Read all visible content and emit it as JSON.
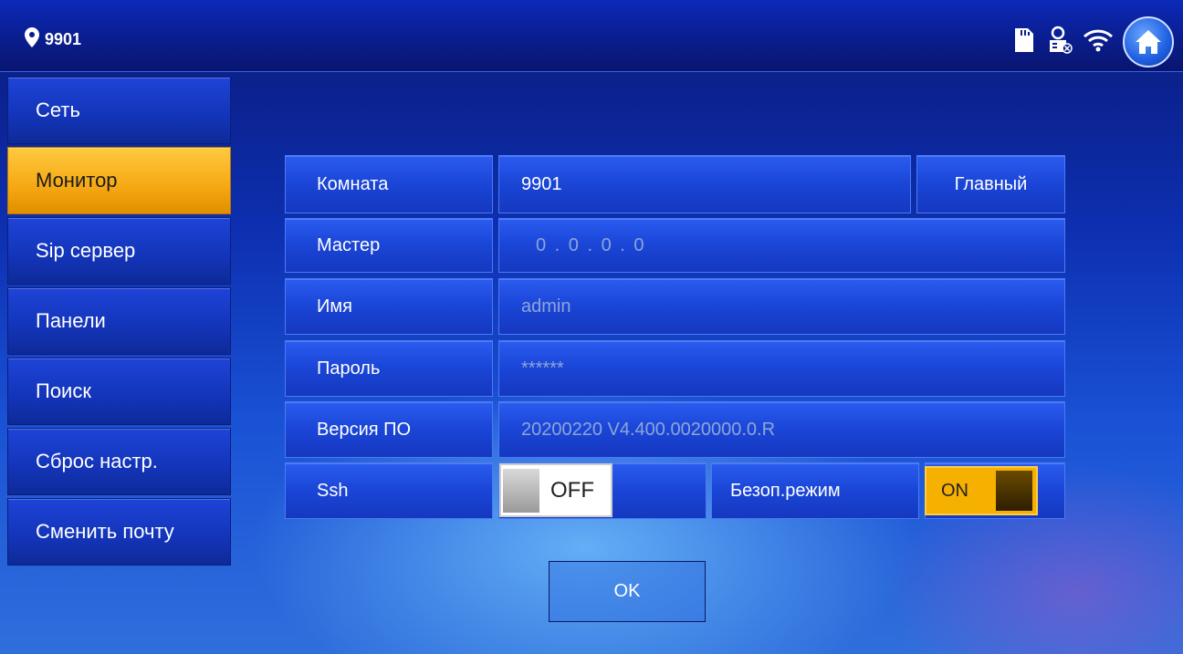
{
  "header": {
    "room_id": "9901"
  },
  "icons": [
    "location-pin-icon",
    "sd-card-icon",
    "sip-status-icon",
    "wifi-icon",
    "home-icon"
  ],
  "sidebar": {
    "items": [
      {
        "label": "Сеть",
        "active": false
      },
      {
        "label": "Монитор",
        "active": true
      },
      {
        "label": "Sip сервер",
        "active": false
      },
      {
        "label": "Панели",
        "active": false
      },
      {
        "label": "Поиск",
        "active": false
      },
      {
        "label": "Сброс настр.",
        "active": false
      },
      {
        "label": "Сменить почту",
        "active": false
      }
    ]
  },
  "form": {
    "room": {
      "label": "Комната",
      "value": "9901",
      "role": "Главный"
    },
    "master": {
      "label": "Мастер",
      "value": "0 . 0 . 0 . 0"
    },
    "name": {
      "label": "Имя",
      "value": "admin"
    },
    "password": {
      "label": "Пароль",
      "value": "******"
    },
    "firmware": {
      "label": "Версия ПО",
      "value": "20200220 V4.400.0020000.0.R"
    },
    "ssh": {
      "label": "Ssh",
      "state": "OFF"
    },
    "safe_mode": {
      "label": "Безоп.режим",
      "state": "ON"
    }
  },
  "ok_button": {
    "label": "OK"
  },
  "colors": {
    "accent": "#f5a812",
    "panel": "#1a45d6",
    "background": "#0d2fb0"
  }
}
